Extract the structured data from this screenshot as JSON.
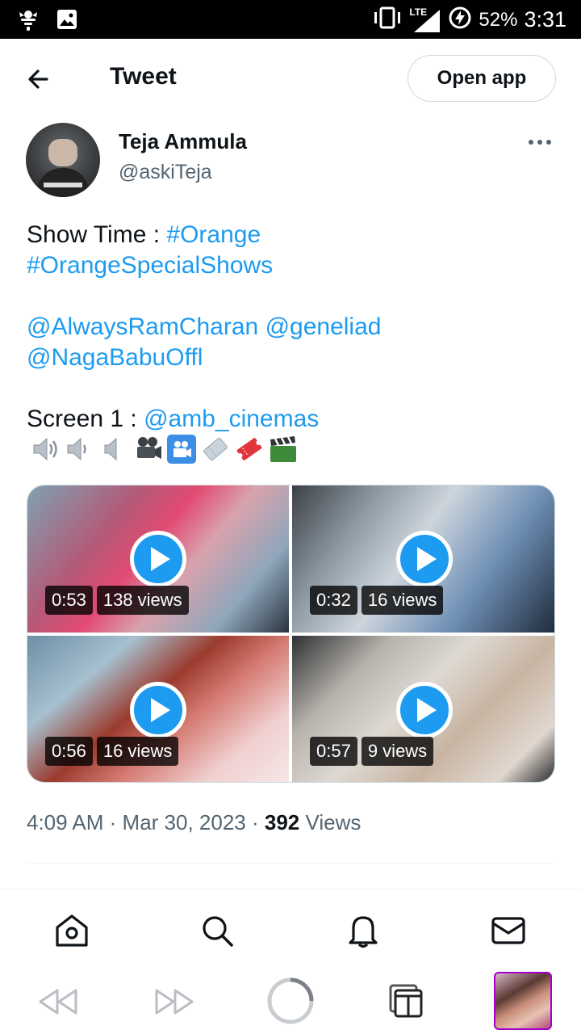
{
  "status_bar": {
    "network": "LTE",
    "battery": "52%",
    "time": "3:31"
  },
  "header": {
    "title": "Tweet",
    "open_app_label": "Open app"
  },
  "author": {
    "name": "Teja Ammula",
    "handle": "@askiTeja"
  },
  "tweet": {
    "line1_text": "Show Time : ",
    "line1_link": "#Orange",
    "line2_link": "#OrangeSpecialShows",
    "line4_link_a": "@AlwaysRamCharan",
    "line4_link_b": "@geneliad",
    "line5_link": "@NagaBabuOffl",
    "line7_text": "Screen 1 : ",
    "line7_link": "@amb_cinemas",
    "emojis": [
      "speaker-high-icon",
      "speaker-low-icon",
      "speaker-mute-icon",
      "movie-camera-icon",
      "cinema-icon",
      "ticket-icon",
      "admission-ticket-icon",
      "clapper-board-icon"
    ]
  },
  "media": [
    {
      "duration": "0:53",
      "views": "138 views"
    },
    {
      "duration": "0:32",
      "views": "16 views"
    },
    {
      "duration": "0:56",
      "views": "16 views"
    },
    {
      "duration": "0:57",
      "views": "9 views"
    }
  ],
  "meta": {
    "time": "4:09 AM",
    "date": "Mar 30, 2023",
    "views_count": "392",
    "views_label": "Views"
  },
  "bottom_nav": [
    "home-icon",
    "search-icon",
    "notifications-icon",
    "messages-icon"
  ],
  "colors": {
    "link": "#1d9bf0",
    "text": "#0f1419",
    "muted": "#536471",
    "border": "#cfd9de"
  }
}
